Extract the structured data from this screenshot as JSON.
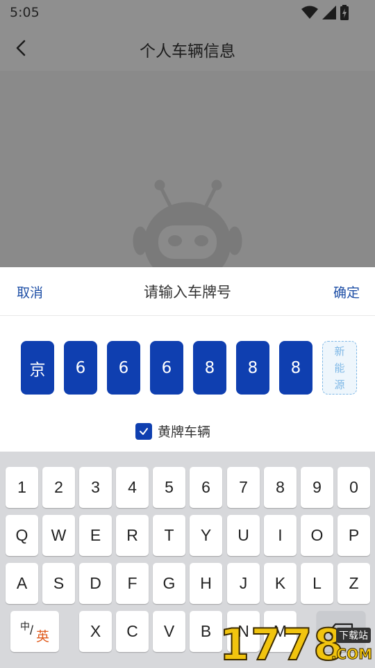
{
  "status_bar": {
    "time": "5:05",
    "icons": [
      "wifi-icon",
      "signal-icon",
      "battery-icon"
    ]
  },
  "app_bar": {
    "back_icon": "chevron-left-icon",
    "title": "个人车辆信息"
  },
  "sheet": {
    "cancel_label": "取消",
    "title": "请输入车牌号",
    "confirm_label": "确定",
    "plate_chars": [
      "京",
      "6",
      "6",
      "6",
      "8",
      "8",
      "8"
    ],
    "new_energy_label": [
      "新",
      "能",
      "源"
    ],
    "yellow_plate_checked": true,
    "yellow_plate_label": "黄牌车辆"
  },
  "keyboard": {
    "row1": [
      "1",
      "2",
      "3",
      "4",
      "5",
      "6",
      "7",
      "8",
      "9",
      "0"
    ],
    "row2": [
      "Q",
      "W",
      "E",
      "R",
      "T",
      "Y",
      "U",
      "I",
      "O",
      "P"
    ],
    "row3": [
      "A",
      "S",
      "D",
      "F",
      "G",
      "H",
      "J",
      "K",
      "L",
      "Z"
    ],
    "row4": [
      "X",
      "C",
      "V",
      "B",
      "N",
      "M"
    ],
    "lang_switch": {
      "zh": "中",
      "slash": "/",
      "en": "英"
    },
    "backspace_icon": "backspace-icon"
  },
  "watermark": {
    "digits": "1778",
    "tag": "下载站",
    "suffix": ".COM"
  },
  "colors": {
    "plate_blue": "#0f3fb0",
    "link_blue": "#1e4fa6",
    "new_energy": "#7fb8e6",
    "lang_en": "#e05a1c"
  }
}
